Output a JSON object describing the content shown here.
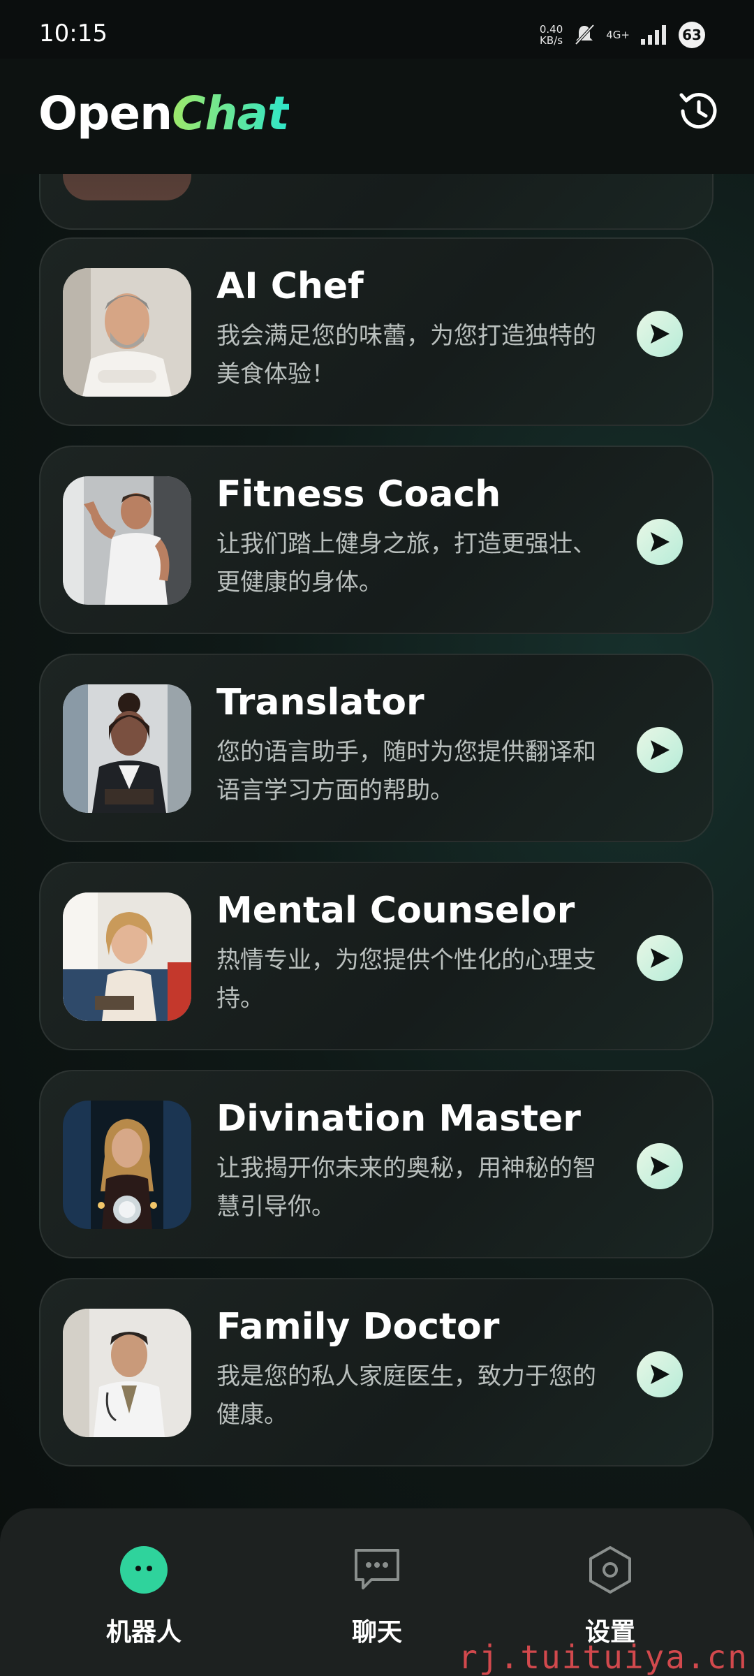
{
  "status_bar": {
    "time": "10:15",
    "net_speed_value": "0.40",
    "net_speed_unit": "KB/s",
    "network_type": "4G+",
    "battery": "63"
  },
  "header": {
    "logo_part1": "Open",
    "logo_part2": "Chat",
    "accent_color": "#3fe6a4"
  },
  "bots": [
    {
      "title": "AI Chef",
      "desc": "我会满足您的味蕾，为您打造独特的美食体验！",
      "avatar": "chef-avatar"
    },
    {
      "title": "Fitness Coach",
      "desc": "让我们踏上健身之旅，打造更强壮、更健康的身体。",
      "avatar": "fitness-avatar"
    },
    {
      "title": "Translator",
      "desc": "您的语言助手，随时为您提供翻译和语言学习方面的帮助。",
      "avatar": "translator-avatar"
    },
    {
      "title": "Mental Counselor",
      "desc": "热情专业，为您提供个性化的心理支持。",
      "avatar": "counselor-avatar"
    },
    {
      "title": "Divination Master",
      "desc": "让我揭开你未来的奥秘，用神秘的智慧引导你。",
      "avatar": "divination-avatar"
    },
    {
      "title": "Family Doctor",
      "desc": "我是您的私人家庭医生，致力于您的健康。",
      "avatar": "doctor-avatar"
    }
  ],
  "nav": {
    "robots": "机器人",
    "chat": "聊天",
    "settings": "设置"
  },
  "watermark": "rj.tuituiya.cn"
}
